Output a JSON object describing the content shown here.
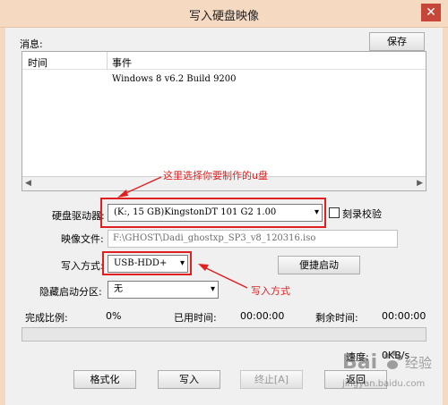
{
  "window": {
    "title": "写入硬盘映像",
    "close_glyph": "✕"
  },
  "messages": {
    "label": "消息:",
    "save_label": "保存",
    "columns": {
      "time": "时间",
      "event": "事件"
    },
    "rows": [
      {
        "time": "",
        "event": "Windows 8 v6.2 Build 9200"
      }
    ]
  },
  "drive": {
    "label": "硬盘驱动器:",
    "selected": "(K:, 15 GB)KingstonDT 101 G2          1.00",
    "verify_label": "刻录校验",
    "verify_checked": false
  },
  "image_file": {
    "label": "映像文件:",
    "value": "F:\\GHOST\\Dadi_ghostxp_SP3_v8_120316.iso"
  },
  "write_mode": {
    "label": "写入方式:",
    "selected": "USB-HDD+",
    "boot_label": "便捷启动"
  },
  "hidden_partition": {
    "label": "隐藏启动分区:",
    "selected": "无"
  },
  "status": {
    "completion_label": "完成比例:",
    "completion_value": "0%",
    "elapsed_label": "已用时间:",
    "elapsed_value": "00:00:00",
    "remaining_label": "剩余时间:",
    "remaining_value": "00:00:00",
    "speed_label": "速度:",
    "speed_value": "0KB/s",
    "progress_fraction": 0
  },
  "buttons": {
    "format": "格式化",
    "write": "写入",
    "stop": "终止[A]",
    "back": "返回"
  },
  "annotations": {
    "drive_note": "这里选择你要制作的u盘",
    "write_mode_note": "写入方式",
    "color": "#e02020"
  },
  "icons": {
    "dropdown": "▾",
    "scroll_left": "◀",
    "scroll_right": "▶"
  },
  "watermark": {
    "text": "Bai",
    "suffix": "经验",
    "url_text": "jingyan.baidu.com"
  },
  "colors": {
    "title_bar": "#f5d9c1",
    "close": "#c7463a",
    "progress": "#06b025"
  }
}
